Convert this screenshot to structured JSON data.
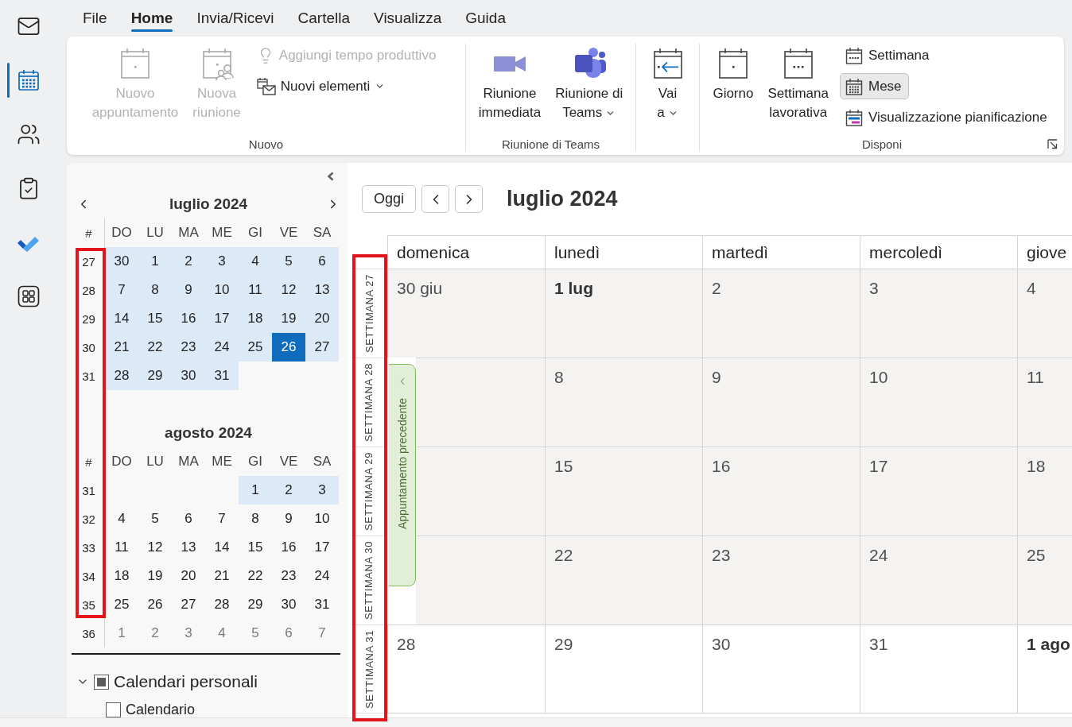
{
  "nav_rail": [
    {
      "selected": false
    },
    {
      "selected": true
    },
    {
      "selected": false
    },
    {
      "selected": false
    },
    {
      "selected": false
    },
    {
      "selected": false
    }
  ],
  "menu_tabs": [
    {
      "label": "File",
      "selected": false
    },
    {
      "label": "Home",
      "selected": true
    },
    {
      "label": "Invia/Ricevi",
      "selected": false
    },
    {
      "label": "Cartella",
      "selected": false
    },
    {
      "label": "Visualizza",
      "selected": false
    },
    {
      "label": "Guida",
      "selected": false
    }
  ],
  "ribbon": {
    "groups": [
      {
        "label": "Nuovo",
        "items": [
          {
            "kind": "large",
            "lines": [
              "Nuovo",
              "appuntamento"
            ],
            "disabled": true,
            "dropdown": false
          },
          {
            "kind": "large",
            "lines": [
              "Nuova",
              "riunione"
            ],
            "disabled": true,
            "dropdown": false
          },
          {
            "kind": "stack",
            "buttons": [
              {
                "label": "Aggiungi tempo produttivo",
                "disabled": true,
                "dropdown": false,
                "selected": false
              },
              {
                "label": "Nuovi elementi",
                "disabled": false,
                "dropdown": true,
                "selected": false
              }
            ]
          }
        ]
      },
      {
        "label": "Riunione di Teams",
        "items": [
          {
            "kind": "large",
            "lines": [
              "Riunione",
              "immediata"
            ],
            "disabled": false,
            "dropdown": false
          },
          {
            "kind": "large",
            "lines": [
              "Riunione di",
              "Teams"
            ],
            "disabled": false,
            "dropdown": true
          }
        ]
      },
      {
        "items": [
          {
            "kind": "large",
            "lines": [
              "Vai",
              "a"
            ],
            "disabled": false,
            "dropdown": true
          }
        ]
      },
      {
        "label": "Disponi",
        "launcher": true,
        "items": [
          {
            "kind": "large",
            "lines": [
              "Giorno"
            ],
            "disabled": false,
            "dropdown": false
          },
          {
            "kind": "large",
            "lines": [
              "Settimana",
              "lavorativa"
            ],
            "disabled": false,
            "dropdown": false
          },
          {
            "kind": "stack",
            "buttons": [
              {
                "label": "Settimana",
                "disabled": false,
                "dropdown": false,
                "selected": false
              },
              {
                "label": "Mese",
                "disabled": false,
                "dropdown": false,
                "selected": true
              },
              {
                "label": "Visualizzazione pianificazione",
                "disabled": false,
                "dropdown": false,
                "selected": false
              }
            ]
          }
        ]
      }
    ]
  },
  "mini_calendar": {
    "months": [
      {
        "title": "luglio 2024",
        "arrows": true,
        "week_header": "#",
        "weekdays": [
          "DO",
          "LU",
          "MA",
          "ME",
          "GI",
          "VE",
          "SA"
        ],
        "weeks": [
          {
            "number": "27",
            "days": [
              {
                "label": "30",
                "in_range": true,
                "selected": false,
                "dimmed": false
              },
              {
                "label": "1",
                "in_range": true,
                "selected": false,
                "dimmed": false
              },
              {
                "label": "2",
                "in_range": true,
                "selected": false,
                "dimmed": false
              },
              {
                "label": "3",
                "in_range": true,
                "selected": false,
                "dimmed": false
              },
              {
                "label": "4",
                "in_range": true,
                "selected": false,
                "dimmed": false
              },
              {
                "label": "5",
                "in_range": true,
                "selected": false,
                "dimmed": false
              },
              {
                "label": "6",
                "in_range": true,
                "selected": false,
                "dimmed": false
              }
            ]
          },
          {
            "number": "28",
            "days": [
              {
                "label": "7",
                "in_range": true,
                "selected": false,
                "dimmed": false
              },
              {
                "label": "8",
                "in_range": true,
                "selected": false,
                "dimmed": false
              },
              {
                "label": "9",
                "in_range": true,
                "selected": false,
                "dimmed": false
              },
              {
                "label": "10",
                "in_range": true,
                "selected": false,
                "dimmed": false
              },
              {
                "label": "11",
                "in_range": true,
                "selected": false,
                "dimmed": false
              },
              {
                "label": "12",
                "in_range": true,
                "selected": false,
                "dimmed": false
              },
              {
                "label": "13",
                "in_range": true,
                "selected": false,
                "dimmed": false
              }
            ]
          },
          {
            "number": "29",
            "days": [
              {
                "label": "14",
                "in_range": true,
                "selected": false,
                "dimmed": false
              },
              {
                "label": "15",
                "in_range": true,
                "selected": false,
                "dimmed": false
              },
              {
                "label": "16",
                "in_range": true,
                "selected": false,
                "dimmed": false
              },
              {
                "label": "17",
                "in_range": true,
                "selected": false,
                "dimmed": false
              },
              {
                "label": "18",
                "in_range": true,
                "selected": false,
                "dimmed": false
              },
              {
                "label": "19",
                "in_range": true,
                "selected": false,
                "dimmed": false
              },
              {
                "label": "20",
                "in_range": true,
                "selected": false,
                "dimmed": false
              }
            ]
          },
          {
            "number": "30",
            "days": [
              {
                "label": "21",
                "in_range": true,
                "selected": false,
                "dimmed": false
              },
              {
                "label": "22",
                "in_range": true,
                "selected": false,
                "dimmed": false
              },
              {
                "label": "23",
                "in_range": true,
                "selected": false,
                "dimmed": false
              },
              {
                "label": "24",
                "in_range": true,
                "selected": false,
                "dimmed": false
              },
              {
                "label": "25",
                "in_range": true,
                "selected": false,
                "dimmed": false
              },
              {
                "label": "26",
                "in_range": true,
                "selected": true,
                "dimmed": false
              },
              {
                "label": "27",
                "in_range": true,
                "selected": false,
                "dimmed": false
              }
            ]
          },
          {
            "number": "31",
            "days": [
              {
                "label": "28",
                "in_range": true,
                "selected": false,
                "dimmed": false
              },
              {
                "label": "29",
                "in_range": true,
                "selected": false,
                "dimmed": false
              },
              {
                "label": "30",
                "in_range": true,
                "selected": false,
                "dimmed": false
              },
              {
                "label": "31",
                "in_range": true,
                "selected": false,
                "dimmed": false
              }
            ]
          }
        ]
      },
      {
        "title": "agosto 2024",
        "week_header": "#",
        "weekdays": [
          "DO",
          "LU",
          "MA",
          "ME",
          "GI",
          "VE",
          "SA"
        ],
        "weeks": [
          {
            "number": "31",
            "days": [
              {
                "label": "1",
                "in_range": true,
                "selected": false,
                "dimmed": false
              },
              {
                "label": "2",
                "in_range": true,
                "selected": false,
                "dimmed": false
              },
              {
                "label": "3",
                "in_range": true,
                "selected": false,
                "dimmed": false
              }
            ]
          },
          {
            "number": "32",
            "days": [
              {
                "label": "4",
                "in_range": false,
                "selected": false,
                "dimmed": false
              },
              {
                "label": "5",
                "in_range": false,
                "selected": false,
                "dimmed": false
              },
              {
                "label": "6",
                "in_range": false,
                "selected": false,
                "dimmed": false
              },
              {
                "label": "7",
                "in_range": false,
                "selected": false,
                "dimmed": false
              },
              {
                "label": "8",
                "in_range": false,
                "selected": false,
                "dimmed": false
              },
              {
                "label": "9",
                "in_range": false,
                "selected": false,
                "dimmed": false
              },
              {
                "label": "10",
                "in_range": false,
                "selected": false,
                "dimmed": false
              }
            ]
          },
          {
            "number": "33",
            "days": [
              {
                "label": "11",
                "in_range": false,
                "selected": false,
                "dimmed": false
              },
              {
                "label": "12",
                "in_range": false,
                "selected": false,
                "dimmed": false
              },
              {
                "label": "13",
                "in_range": false,
                "selected": false,
                "dimmed": false
              },
              {
                "label": "14",
                "in_range": false,
                "selected": false,
                "dimmed": false
              },
              {
                "label": "15",
                "in_range": false,
                "selected": false,
                "dimmed": false
              },
              {
                "label": "16",
                "in_range": false,
                "selected": false,
                "dimmed": false
              },
              {
                "label": "17",
                "in_range": false,
                "selected": false,
                "dimmed": false
              }
            ]
          },
          {
            "number": "34",
            "days": [
              {
                "label": "18",
                "in_range": false,
                "selected": false,
                "dimmed": false
              },
              {
                "label": "19",
                "in_range": false,
                "selected": false,
                "dimmed": false
              },
              {
                "label": "20",
                "in_range": false,
                "selected": false,
                "dimmed": false
              },
              {
                "label": "21",
                "in_range": false,
                "selected": false,
                "dimmed": false
              },
              {
                "label": "22",
                "in_range": false,
                "selected": false,
                "dimmed": false
              },
              {
                "label": "23",
                "in_range": false,
                "selected": false,
                "dimmed": false
              },
              {
                "label": "24",
                "in_range": false,
                "selected": false,
                "dimmed": false
              }
            ]
          },
          {
            "number": "35",
            "days": [
              {
                "label": "25",
                "in_range": false,
                "selected": false,
                "dimmed": false
              },
              {
                "label": "26",
                "in_range": false,
                "selected": false,
                "dimmed": false
              },
              {
                "label": "27",
                "in_range": false,
                "selected": false,
                "dimmed": false
              },
              {
                "label": "28",
                "in_range": false,
                "selected": false,
                "dimmed": false
              },
              {
                "label": "29",
                "in_range": false,
                "selected": false,
                "dimmed": false
              },
              {
                "label": "30",
                "in_range": false,
                "selected": false,
                "dimmed": false
              },
              {
                "label": "31",
                "in_range": false,
                "selected": false,
                "dimmed": false
              }
            ]
          },
          {
            "number": "36",
            "days": [
              {
                "label": "1",
                "in_range": false,
                "selected": false,
                "dimmed": true
              },
              {
                "label": "2",
                "in_range": false,
                "selected": false,
                "dimmed": true
              },
              {
                "label": "3",
                "in_range": false,
                "selected": false,
                "dimmed": true
              },
              {
                "label": "4",
                "in_range": false,
                "selected": false,
                "dimmed": true
              },
              {
                "label": "5",
                "in_range": false,
                "selected": false,
                "dimmed": true
              },
              {
                "label": "6",
                "in_range": false,
                "selected": false,
                "dimmed": true
              },
              {
                "label": "7",
                "in_range": false,
                "selected": false,
                "dimmed": true
              }
            ]
          }
        ]
      }
    ]
  },
  "calendar_folders": {
    "label": "Calendari personali",
    "expanded": true,
    "checked": false,
    "mixed": true,
    "children": [
      {
        "label": "Calendario",
        "checked": false
      }
    ]
  },
  "calendar": {
    "today_button": "Oggi",
    "title": "luglio 2024",
    "columns": [
      "domenica",
      "lunedì",
      "martedì",
      "mercoledì",
      "giove"
    ],
    "weeks": [
      {
        "label": "SETTIMANA 27",
        "shaded": true,
        "days": [
          {
            "label": "30 giu",
            "bold": false
          },
          {
            "label": "1 lug",
            "bold": true
          },
          {
            "label": "2",
            "bold": false
          },
          {
            "label": "3",
            "bold": false
          },
          {
            "label": "4",
            "bold": false
          }
        ]
      },
      {
        "label": "SETTIMANA 28",
        "shaded": true,
        "days": [
          {
            "label": "8",
            "bold": false
          },
          {
            "label": "9",
            "bold": false
          },
          {
            "label": "10",
            "bold": false
          },
          {
            "label": "11",
            "bold": false
          }
        ]
      },
      {
        "label": "SETTIMANA 29",
        "shaded": true,
        "days": [
          {
            "label": "15",
            "bold": false
          },
          {
            "label": "16",
            "bold": false
          },
          {
            "label": "17",
            "bold": false
          },
          {
            "label": "18",
            "bold": false
          }
        ]
      },
      {
        "label": "SETTIMANA 30",
        "shaded": true,
        "days": [
          {
            "label": "22",
            "bold": false
          },
          {
            "label": "23",
            "bold": false
          },
          {
            "label": "24",
            "bold": false
          },
          {
            "label": "25",
            "bold": false
          }
        ]
      },
      {
        "label": "SETTIMANA 31",
        "shaded": false,
        "days": [
          {
            "label": "28",
            "bold": false
          },
          {
            "label": "29",
            "bold": false
          },
          {
            "label": "30",
            "bold": false
          },
          {
            "label": "31",
            "bold": false
          },
          {
            "label": "1 ago",
            "bold": true
          }
        ]
      }
    ],
    "previous_appointment": {
      "label": "Appuntamento precedente"
    }
  }
}
